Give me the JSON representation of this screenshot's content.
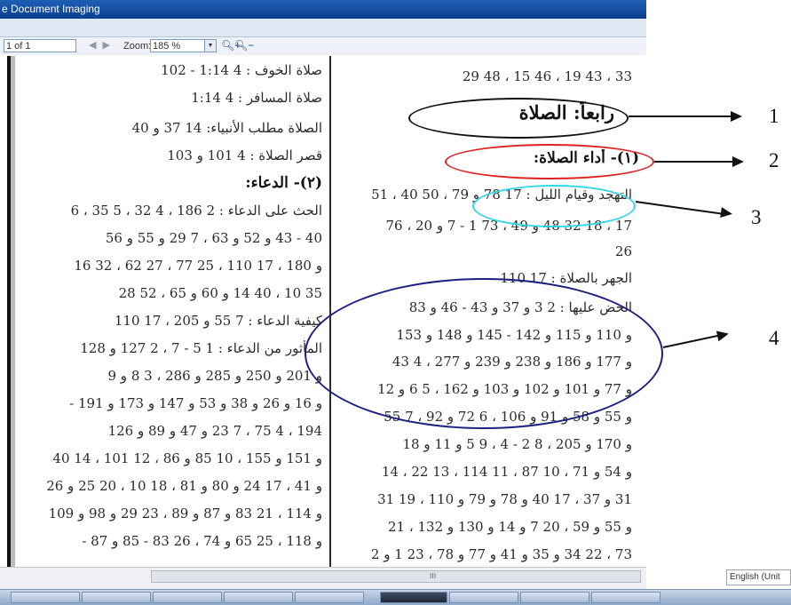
{
  "window": {
    "title": "e Document Imaging"
  },
  "toolbar": {
    "page_value": "1 of 1",
    "nav_arrows": "◀ ▶",
    "zoom_label": "Zoom:",
    "zoom_value": "185 %",
    "zoom_in_icon": "zoom-in-magnifier",
    "zoom_out_icon": "zoom-out-magnifier"
  },
  "document": {
    "left_column": [
      {
        "text": "صلاة الخوف : 4 1:14 - 102",
        "style": "line"
      },
      {
        "text": "صلاة المسافر : 4 1:14",
        "style": "line"
      },
      {
        "text": "الصلاة مطلب الأنبياء: 14 37 و 40",
        "style": "line"
      },
      {
        "text": "قصر الصلاة : 4 101 و 103",
        "style": "line"
      },
      {
        "text": "(٢)- الدعاء:",
        "style": "bold"
      },
      {
        "text": "الحث على الدعاء : 2 186 ، 4 32 ، 5 35 ، 6",
        "style": "line"
      },
      {
        "text": "40 - 43 و 52 و 63 ، 7 29 و 55 و 56",
        "style": "line"
      },
      {
        "text": "و 180 ، 17 110 ، 25 77 ، 27 62 ، 32 16",
        "style": "line"
      },
      {
        "text": "35 10 ، 40 14 و 60 و 65 ، 52 28",
        "style": "line"
      },
      {
        "text": "كيفية الدعاء : 7 55 و 205 ، 17 110",
        "style": "line"
      },
      {
        "text": "المأثور من الدعاء : 1 5 - 7 ، 2 127 و 128",
        "style": "line"
      },
      {
        "text": "و 201 و 250 و 285 و 286 ، 3 8 و 9",
        "style": "line"
      },
      {
        "text": "و 16 و 26 و 38 و 53 و 147 و 173 و 191 -",
        "style": "line"
      },
      {
        "text": "194 ، 4 75 ، 7 23 و 47 و 89 و 126",
        "style": "line"
      },
      {
        "text": "و 151 و 155 ، 10 85 و 86 ، 12 101 ، 14 40",
        "style": "line"
      },
      {
        "text": "و 41 ، 17 24 و 80 و 81 ، 18 10 ، 20 25 و 26",
        "style": "line"
      },
      {
        "text": "و 114 ، 21 83 و 87 و 89 ، 23 29 و 98 و 109",
        "style": "line"
      },
      {
        "text": "و 118 ، 25 65 و 74 ، 26 83 - 85 و 87 -",
        "style": "line"
      }
    ],
    "right_column": [
      {
        "text": "33 ، 43 19 ، 46 15 ، 48 29",
        "style": "line"
      },
      {
        "text": "رابعاً: الصلاة",
        "style": "heading"
      },
      {
        "text": "(١)- أداء الصلاة:",
        "style": "bold"
      },
      {
        "text": "التهجد وقيام الليل : 17 78 و 79 ، 50 40 ، 51",
        "style": "line"
      },
      {
        "text": "17 ، 18 32 48 و 49 ، 73 1 - 7 و 20 ، 76",
        "style": "line"
      },
      {
        "text": "26",
        "style": "line"
      },
      {
        "text": "الجهر بالصلاة : 17 110",
        "style": "line"
      },
      {
        "text": "الحض عليها : 2 3 و 37 و 43 - 46 و 83",
        "style": "line"
      },
      {
        "text": "و 110 و 115 و 142 - 145 و 148 و 153",
        "style": "line"
      },
      {
        "text": "و 177 و 186 و 238 و 239 و 277 ، 4 43",
        "style": "line"
      },
      {
        "text": "و 77 و 101 و 102 و 103 و 162 ، 5 6 و 12",
        "style": "line"
      },
      {
        "text": "و 55 و 58 و 91 و 106 ، 6 72 و 92 ، 7 55",
        "style": "line"
      },
      {
        "text": "و 170 و 205 ، 8 2 - 4 ، 9 5 و 11 و 18",
        "style": "line"
      },
      {
        "text": "و 54 و 71 ، 10 87 ، 11 114 ، 13 22 ، 14",
        "style": "line"
      },
      {
        "text": "31 و 37 ، 17 40 و 78 و 79 و 110 ، 19 31",
        "style": "line"
      },
      {
        "text": "و 55 و 59 ، 20 7 و 14 و 130 و 132 ، 21",
        "style": "line"
      },
      {
        "text": "73 ، 22 34 و 35 و 41 و 77 و 78 ، 23 1 و 2",
        "style": "line"
      }
    ]
  },
  "annotations": [
    {
      "number": "1",
      "color": "#111111"
    },
    {
      "number": "2",
      "color": "#e02020"
    },
    {
      "number": "3",
      "color": "#2fd7e6"
    },
    {
      "number": "4",
      "color": "#1b1f80"
    }
  ],
  "scrollbar": {
    "grip": "III"
  },
  "statusbar": {
    "language": "English (Unit"
  }
}
